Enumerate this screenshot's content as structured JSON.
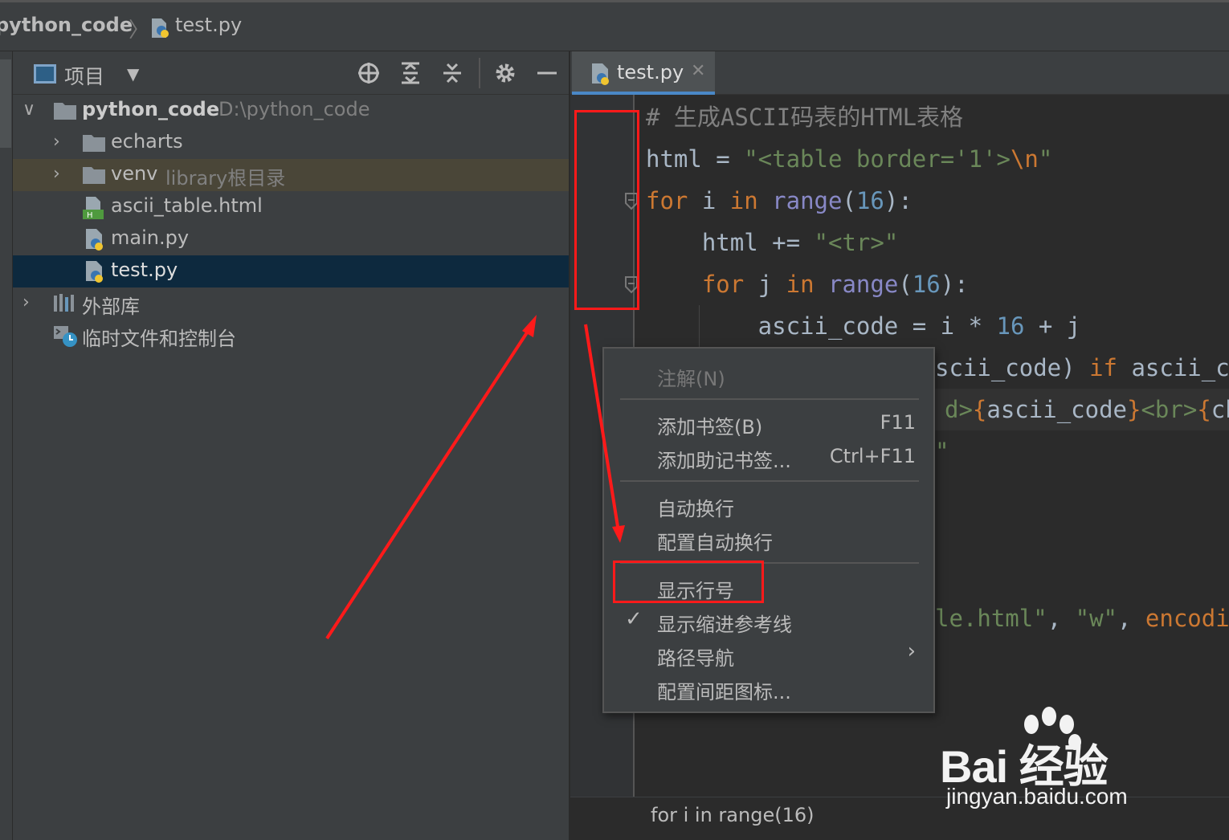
{
  "navbar": {
    "project": "python_code",
    "file": "test.py"
  },
  "project_panel": {
    "title": "项目",
    "toolbar_icons": [
      "locate-icon",
      "expand-all-icon",
      "collapse-all-icon",
      "gear-icon",
      "hide-icon"
    ],
    "tree": [
      {
        "name": "python_code",
        "hint": "D:\\python_code",
        "type": "folder"
      },
      {
        "name": "echarts",
        "hint": "",
        "type": "folder"
      },
      {
        "name": "venv",
        "hint": "library根目录",
        "type": "folder"
      },
      {
        "name": "ascii_table.html",
        "hint": "",
        "type": "html-file"
      },
      {
        "name": "main.py",
        "hint": "",
        "type": "python-file"
      },
      {
        "name": "test.py",
        "hint": "",
        "type": "python-file"
      },
      {
        "name": "外部库",
        "hint": "",
        "type": "library"
      },
      {
        "name": "临时文件和控制台",
        "hint": "",
        "type": "scratches"
      }
    ]
  },
  "editor": {
    "tab": "test.py",
    "bottom_breadcrumb": "for i in range(16)"
  },
  "context_menu": {
    "items": [
      {
        "label": "注解(N)",
        "shortcut": "",
        "disabled": true
      },
      {
        "label": "添加书签(B)",
        "shortcut": "F11"
      },
      {
        "label": "添加助记书签...",
        "shortcut": "Ctrl+F11"
      },
      {
        "label": "自动换行",
        "shortcut": ""
      },
      {
        "label": "配置自动换行",
        "shortcut": ""
      },
      {
        "label": "显示行号",
        "shortcut": ""
      },
      {
        "label": "显示缩进参考线",
        "shortcut": "",
        "checked": true
      },
      {
        "label": "路径导航",
        "shortcut": "",
        "submenu": true
      },
      {
        "label": "配置间距图标...",
        "shortcut": ""
      }
    ]
  },
  "watermark": {
    "brand": "Bai 经验",
    "url": "jingyan.baidu.com"
  },
  "colors": {
    "annotation": "#ff1a1a",
    "selection": "#0d293e",
    "panel": "#3c3f41",
    "editor": "#2b2b2b"
  }
}
